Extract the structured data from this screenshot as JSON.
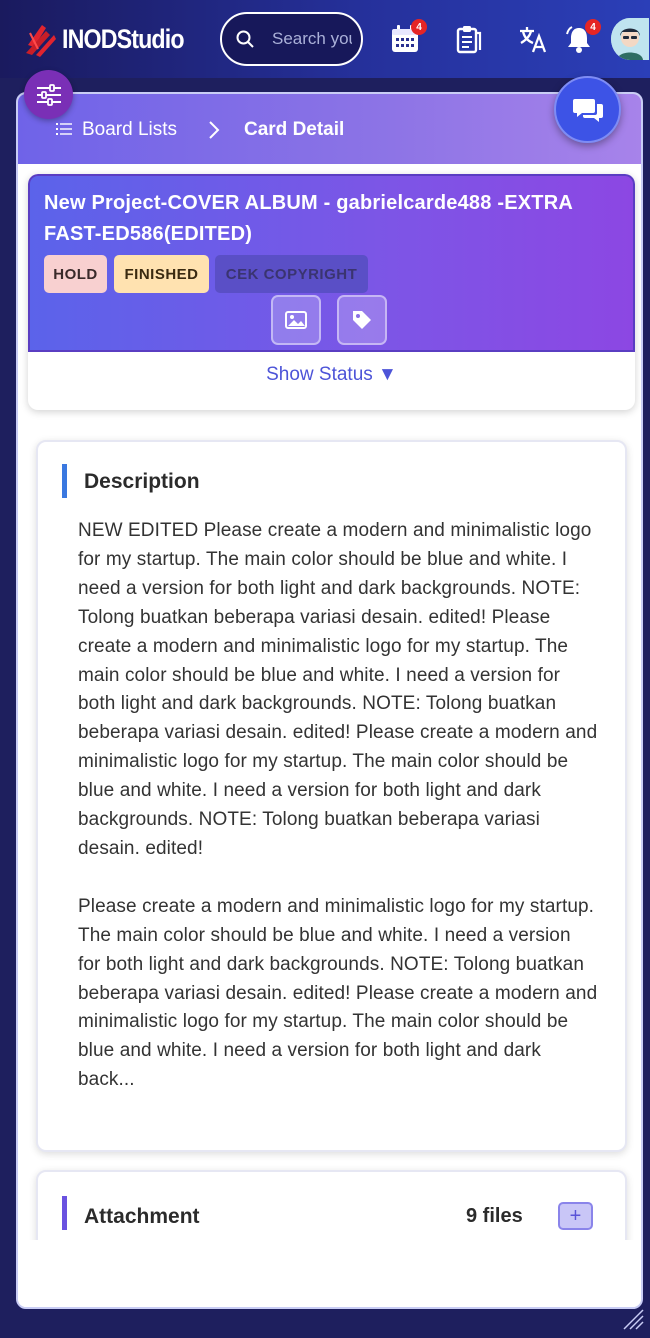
{
  "header": {
    "logo_text": "INODStudio",
    "search_placeholder": "Search your",
    "calendar_badge": "4",
    "notification_badge": "4",
    "icons": [
      "calendar-icon",
      "clipboard-icon",
      "translate-icon",
      "bell-icon"
    ]
  },
  "breadcrumb": {
    "parent": "Board Lists",
    "current": "Card Detail"
  },
  "project": {
    "title": "New Project-COVER ALBUM - gabrielcarde488 -EXTRA FAST-ED586(EDITED)",
    "tags": [
      "HOLD",
      "FINISHED",
      "CEK COPYRIGHT"
    ],
    "show_status": "Show Status ▼"
  },
  "description": {
    "title": "Description",
    "text": "NEW EDITED Please create a modern and minimalistic logo for my startup. The main color should be blue and white. I need a version for both light and dark backgrounds. NOTE: Tolong buatkan beberapa variasi desain. edited! Please create a modern and minimalistic logo for my startup. The main color should be blue and white. I need a version for both light and dark backgrounds. NOTE: Tolong buatkan beberapa variasi desain. edited! Please create a modern and minimalistic logo for my startup. The main color should be blue and white. I need a version for both light and dark backgrounds. NOTE: Tolong buatkan beberapa variasi desain. edited!\n\nPlease create a modern and minimalistic logo for my startup. The main color should be blue and white. I need a version for both light and dark backgrounds. NOTE: Tolong buatkan beberapa variasi desain. edited! Please create a modern and minimalistic logo for my startup. The main color should be blue and white. I need a version for both light and dark back..."
  },
  "attachment": {
    "title": "Attachment",
    "count": "9 files",
    "add_label": "+"
  },
  "colors": {
    "accent": "#4d54d8",
    "header_bg": "#1a1a5e",
    "badge": "#e52525"
  }
}
